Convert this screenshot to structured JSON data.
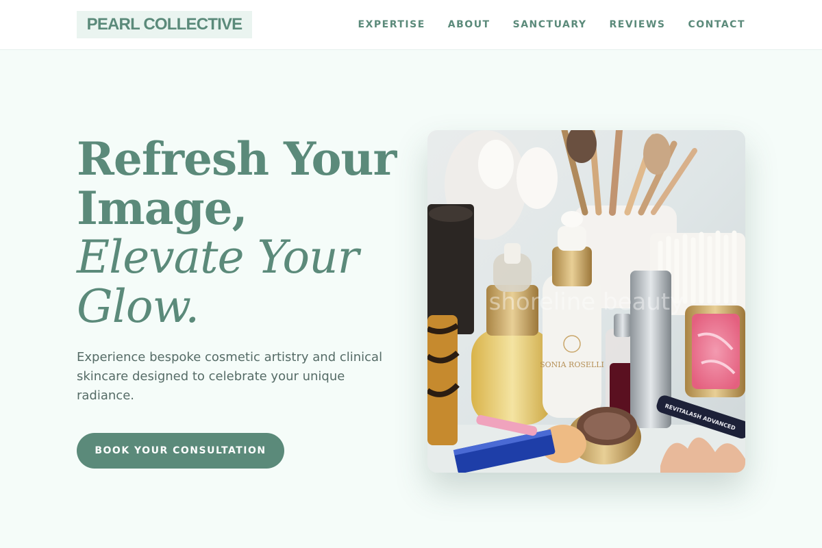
{
  "header": {
    "logo": "PEARL COLLECTIVE",
    "nav": [
      "EXPERTISE",
      "ABOUT",
      "SANCTUARY",
      "REVIEWS",
      "CONTACT"
    ]
  },
  "hero": {
    "headline_line1": "Refresh Your",
    "headline_line2": "Image,",
    "headline_line3": "Elevate Your",
    "headline_line4": "Glow.",
    "subtitle": "Experience bespoke cosmetic artistry and clinical skincare designed to celebrate your unique radiance.",
    "cta_label": "BOOK YOUR CONSULTATION",
    "image": {
      "watermark": "shoreline beauty",
      "serum_brand": "SONIA ROSELLI",
      "mascara_label": "REVITALASH ADVANCED"
    }
  },
  "colors": {
    "accent": "#5b8a7a",
    "background": "#f5fcf9",
    "logo_bg": "#eaf4f0",
    "body_text": "#556b66"
  }
}
